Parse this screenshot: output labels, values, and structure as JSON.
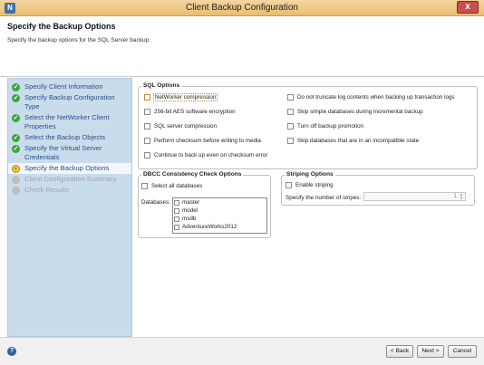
{
  "window": {
    "title": "Client Backup Configuration",
    "close_label": "x",
    "icon_letter": "N"
  },
  "header": {
    "title": "Specify the Backup Options",
    "subtitle": "Specify the backup options for the SQL Server backup."
  },
  "sidebar": {
    "steps": [
      {
        "label": "Specify Client Information",
        "state": "done"
      },
      {
        "label": "Specify Backup Configuration Type",
        "state": "done"
      },
      {
        "label": "Select the NetWorker Client Properties",
        "state": "done"
      },
      {
        "label": "Select the Backup Objects",
        "state": "done"
      },
      {
        "label": "Specify the Virtual Server Credentials",
        "state": "done"
      },
      {
        "label": "Specify the Backup Options",
        "state": "current"
      },
      {
        "label": "Client Configuration Summary",
        "state": "pending"
      },
      {
        "label": "Check Results",
        "state": "pending"
      }
    ]
  },
  "sql_options": {
    "legend": "SQL Options",
    "left": [
      "NetWorker compression",
      "256-bit AES software encryption",
      "SQL server compression",
      "Perform checksum before writing to media",
      "Continue to back up even on checksum error"
    ],
    "right": [
      "Do not truncate log contents when backing up transaction logs",
      "Skip simple databases during incremental backup",
      "Turn off backup promotion",
      "Skip databases that are in an incompatible state"
    ]
  },
  "dbcc": {
    "legend": "DBCC Consistency Check Options",
    "select_all": "Select all databases",
    "databases_label": "Databases:",
    "databases": [
      "master",
      "model",
      "msdb",
      "AdventureWorks2012"
    ]
  },
  "striping": {
    "legend": "Striping Options",
    "enable": "Enable striping",
    "count_label": "Specify the number of stripes:",
    "count_value": "1"
  },
  "footer": {
    "help": "?",
    "back": "< Back",
    "next": "Next >",
    "cancel": "Cancel"
  }
}
